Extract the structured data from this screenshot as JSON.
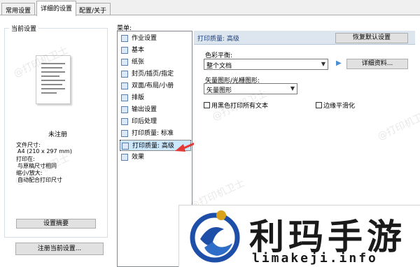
{
  "tabs": [
    {
      "label": "常用设置"
    },
    {
      "label": "详细的设置"
    },
    {
      "label": "配置/关于"
    }
  ],
  "current_settings": {
    "title": "当前设置",
    "status": "未注册",
    "file_size_label": "文件尺寸:",
    "file_size_value": "A4 (210 x 297 mm)",
    "print_on_label": "打印在:",
    "print_on_value": "与原稿尺寸相同",
    "scale_label": "缩小/放大:",
    "scale_value": "自动配合打印尺寸",
    "summary_button": "设置摘要",
    "register_button": "注册当前设置..."
  },
  "menu": {
    "label": "菜单:",
    "items": [
      {
        "label": "作业设置"
      },
      {
        "label": "基本"
      },
      {
        "label": "纸张"
      },
      {
        "label": "封页/插页/指定"
      },
      {
        "label": "双面/布局/小册"
      },
      {
        "label": "排版"
      },
      {
        "label": "输出设置"
      },
      {
        "label": "印后处理"
      },
      {
        "label": "打印质量: 标准"
      },
      {
        "label": "打印质量: 高级"
      },
      {
        "label": "效果"
      }
    ],
    "selected_index": 9
  },
  "panel": {
    "title": "打印质量: 高级",
    "restore_button": "恢复默认设置",
    "color_balance_label": "色彩平衡:",
    "color_balance_value": "整个文档",
    "details_button": "详细资料...",
    "vector_label": "矢量图形/光栅图形:",
    "vector_value": "矢量图形",
    "print_black_label": "用黑色打印所有文本",
    "print_black_checked": false,
    "edge_smooth_label": "边缘平滑化",
    "edge_smooth_checked": false
  },
  "watermark_text": "@打印机卫士",
  "overlay": {
    "brand_name": "利玛手游",
    "brand_url": "limakeji.info"
  },
  "colors": {
    "header_bg": "#dde6ef",
    "selection_bg": "#cce8ff",
    "arrow": "#e53935",
    "logo_blue": "#1e4fa8",
    "logo_gold": "#d9a21b"
  }
}
